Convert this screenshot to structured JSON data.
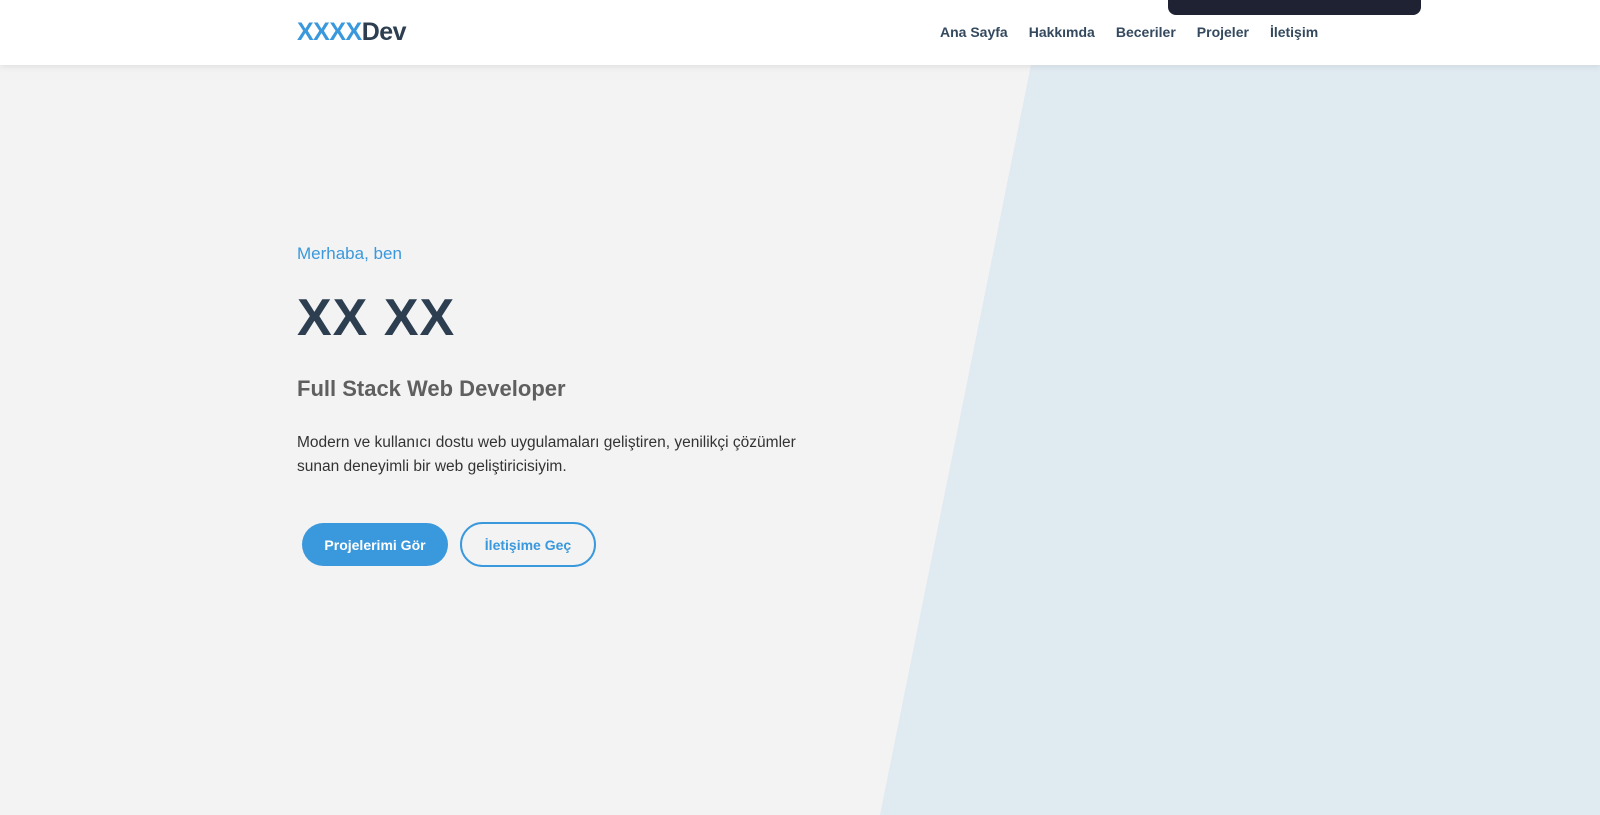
{
  "header": {
    "logo_primary": "XXXX",
    "logo_secondary": "Dev",
    "nav": [
      {
        "label": "Ana Sayfa"
      },
      {
        "label": "Hakkımda"
      },
      {
        "label": "Beceriler"
      },
      {
        "label": "Projeler"
      },
      {
        "label": "İletişim"
      }
    ]
  },
  "hero": {
    "greeting": "Merhaba, ben",
    "name": "XX XX",
    "role": "Full Stack Web Developer",
    "description": "Modern ve kullanıcı dostu web uygulamaları geliştiren, yenilikçi çözümler sunan deneyimli bir web geliştiricisiyim.",
    "primary_button": "Projelerimi Gör",
    "secondary_button": "İletişime Geç"
  },
  "colors": {
    "accent": "#3a98dc",
    "heading": "#2c3e50",
    "background": "#f3f3f3",
    "diagonal_panel": "#e0eaf1",
    "top_bar": "#1e2233"
  }
}
